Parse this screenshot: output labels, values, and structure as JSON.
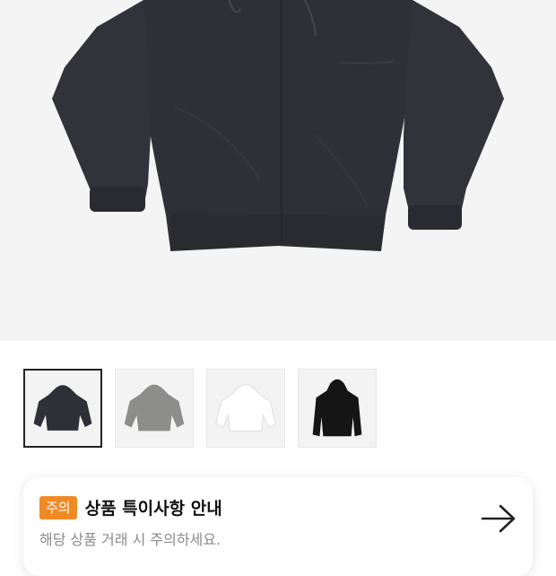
{
  "product": {
    "hero_image": "hoodie-dark-charcoal",
    "thumbnails": [
      {
        "name": "hoodie-dark-charcoal",
        "color": "#2f3037",
        "selected": true
      },
      {
        "name": "hoodie-gray",
        "color": "#8d8d8b",
        "selected": false
      },
      {
        "name": "hoodie-white",
        "color": "#f2f2f2",
        "selected": false
      },
      {
        "name": "hoodie-black",
        "color": "#151515",
        "selected": false
      }
    ]
  },
  "notice": {
    "badge": "주의",
    "title": "상품 특이사항 안내",
    "subtitle": "해당 상품 거래 시 주의하세요.",
    "arrow_icon": "arrow-right-icon",
    "badge_color": "#f08a24"
  }
}
